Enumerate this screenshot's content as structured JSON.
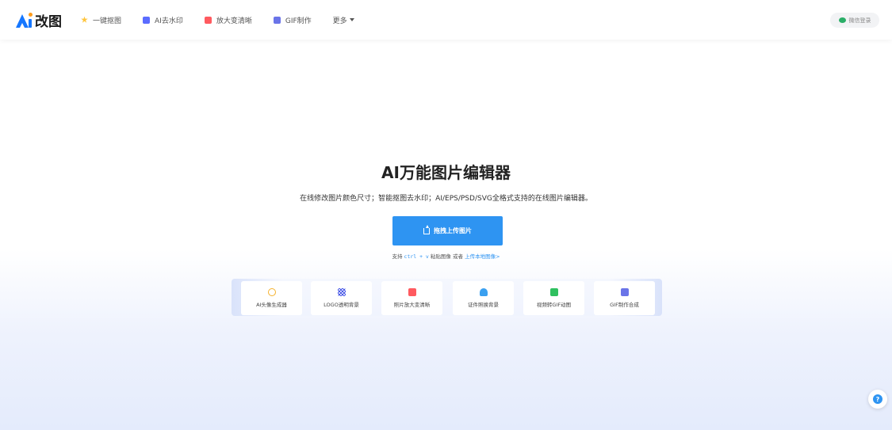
{
  "header": {
    "logo_text": "改图",
    "nav": [
      {
        "label": "一键抠图",
        "icon": "star-icon"
      },
      {
        "label": "AI去水印",
        "icon": "ai-icon"
      },
      {
        "label": "放大变清晰",
        "icon": "zoom-icon"
      },
      {
        "label": "GIF制作",
        "icon": "gif-icon"
      },
      {
        "label": "更多",
        "icon": "chevron-down-icon"
      }
    ],
    "login_label": "微信登录"
  },
  "hero": {
    "title": "AI万能图片编辑器",
    "subtitle": "在线修改图片颜色尺寸；智能抠图去水印；AI/EPS/PSD/SVG全格式支持的在线图片编辑器。",
    "upload_label": "拖拽上传图片",
    "hint_prefix": "支持",
    "hint_kbd": "ctrl + v",
    "hint_mid": "粘贴图像 或者",
    "hint_link": "上传本地图像>"
  },
  "tools": [
    {
      "label": "AI头像生成器",
      "icon": "avatar-icon"
    },
    {
      "label": "LOGO透明背景",
      "icon": "checker-icon"
    },
    {
      "label": "照片放大变清晰",
      "icon": "zoom-icon"
    },
    {
      "label": "证件照换背景",
      "icon": "id-photo-icon"
    },
    {
      "label": "视频转GIF动图",
      "icon": "video-icon"
    },
    {
      "label": "GIF制作合成",
      "icon": "gif-icon"
    }
  ],
  "colors": {
    "accent": "#2e94f2",
    "brand": "#1677ff"
  }
}
